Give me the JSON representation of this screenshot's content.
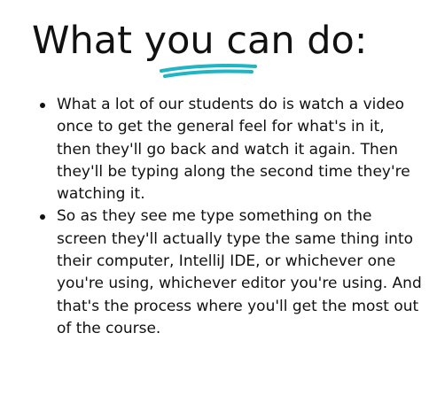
{
  "heading": "What you can do:",
  "accent_color": "#1fb5c4",
  "bullets": [
    "What a lot of our students do is watch a video once to get the general feel for what's in it, then they'll go back and watch it again. Then they'll be typing along the second time they're watching it.",
    "So as they see me type something on the screen they'll actually type the same thing into their computer, IntelliJ IDE, or whichever one you're using, whichever editor you're using. And that's the process where you'll get the most out of the course."
  ]
}
